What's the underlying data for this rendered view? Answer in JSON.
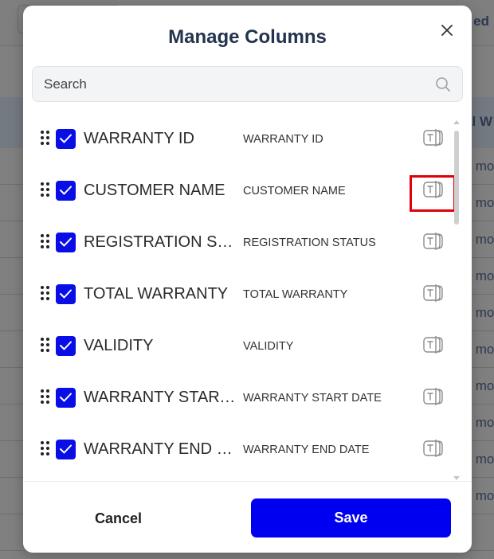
{
  "background": {
    "header_fragment": "ed",
    "column_fragment": "tal W",
    "row_fragment": "mor"
  },
  "modal": {
    "title": "Manage Columns",
    "close_icon": "close-icon"
  },
  "search": {
    "placeholder": "Search",
    "value": "",
    "icon": "search-icon"
  },
  "columns": [
    {
      "label": "WARRANTY ID",
      "field": "WARRANTY ID",
      "checked": true,
      "type_icon": "text-type-icon"
    },
    {
      "label": "CUSTOMER NAME",
      "field": "CUSTOMER NAME",
      "checked": true,
      "type_icon": "text-type-icon"
    },
    {
      "label": "REGISTRATION STATUS",
      "field": "REGISTRATION STATUS",
      "checked": true,
      "type_icon": "text-type-icon"
    },
    {
      "label": "TOTAL WARRANTY",
      "field": "TOTAL WARRANTY",
      "checked": true,
      "type_icon": "text-type-icon"
    },
    {
      "label": "VALIDITY",
      "field": "VALIDITY",
      "checked": true,
      "type_icon": "text-type-icon"
    },
    {
      "label": "WARRANTY START DATE",
      "field": "WARRANTY START DATE",
      "checked": true,
      "type_icon": "text-type-icon"
    },
    {
      "label": "WARRANTY END DATE",
      "field": "WARRANTY END DATE",
      "checked": true,
      "type_icon": "text-type-icon"
    }
  ],
  "footer": {
    "cancel_label": "Cancel",
    "save_label": "Save"
  },
  "colors": {
    "accent": "#0000f0",
    "checkbox": "#0a0ee6",
    "highlight": "#e0000a",
    "title": "#23324d"
  }
}
